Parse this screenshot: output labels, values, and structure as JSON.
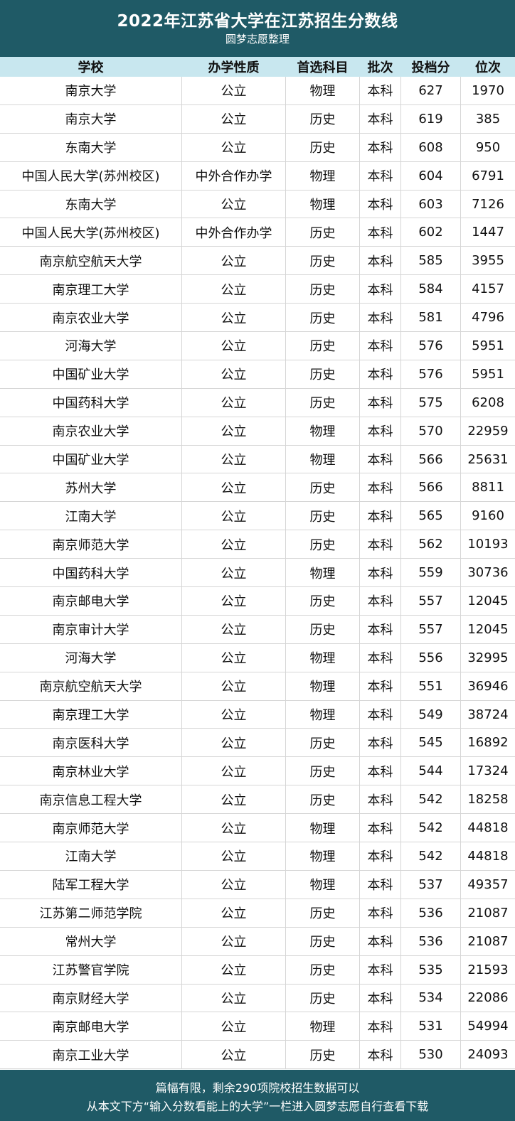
{
  "header": {
    "title": "2022年江苏省大学在江苏招生分数线",
    "subtitle": "圆梦志愿整理"
  },
  "columns": [
    "学校",
    "办学性质",
    "首选科目",
    "批次",
    "投档分",
    "位次"
  ],
  "rows": [
    [
      "南京大学",
      "公立",
      "物理",
      "本科",
      "627",
      "1970"
    ],
    [
      "南京大学",
      "公立",
      "历史",
      "本科",
      "619",
      "385"
    ],
    [
      "东南大学",
      "公立",
      "历史",
      "本科",
      "608",
      "950"
    ],
    [
      "中国人民大学(苏州校区)",
      "中外合作办学",
      "物理",
      "本科",
      "604",
      "6791"
    ],
    [
      "东南大学",
      "公立",
      "物理",
      "本科",
      "603",
      "7126"
    ],
    [
      "中国人民大学(苏州校区)",
      "中外合作办学",
      "历史",
      "本科",
      "602",
      "1447"
    ],
    [
      "南京航空航天大学",
      "公立",
      "历史",
      "本科",
      "585",
      "3955"
    ],
    [
      "南京理工大学",
      "公立",
      "历史",
      "本科",
      "584",
      "4157"
    ],
    [
      "南京农业大学",
      "公立",
      "历史",
      "本科",
      "581",
      "4796"
    ],
    [
      "河海大学",
      "公立",
      "历史",
      "本科",
      "576",
      "5951"
    ],
    [
      "中国矿业大学",
      "公立",
      "历史",
      "本科",
      "576",
      "5951"
    ],
    [
      "中国药科大学",
      "公立",
      "历史",
      "本科",
      "575",
      "6208"
    ],
    [
      "南京农业大学",
      "公立",
      "物理",
      "本科",
      "570",
      "22959"
    ],
    [
      "中国矿业大学",
      "公立",
      "物理",
      "本科",
      "566",
      "25631"
    ],
    [
      "苏州大学",
      "公立",
      "历史",
      "本科",
      "566",
      "8811"
    ],
    [
      "江南大学",
      "公立",
      "历史",
      "本科",
      "565",
      "9160"
    ],
    [
      "南京师范大学",
      "公立",
      "历史",
      "本科",
      "562",
      "10193"
    ],
    [
      "中国药科大学",
      "公立",
      "物理",
      "本科",
      "559",
      "30736"
    ],
    [
      "南京邮电大学",
      "公立",
      "历史",
      "本科",
      "557",
      "12045"
    ],
    [
      "南京审计大学",
      "公立",
      "历史",
      "本科",
      "557",
      "12045"
    ],
    [
      "河海大学",
      "公立",
      "物理",
      "本科",
      "556",
      "32995"
    ],
    [
      "南京航空航天大学",
      "公立",
      "物理",
      "本科",
      "551",
      "36946"
    ],
    [
      "南京理工大学",
      "公立",
      "物理",
      "本科",
      "549",
      "38724"
    ],
    [
      "南京医科大学",
      "公立",
      "历史",
      "本科",
      "545",
      "16892"
    ],
    [
      "南京林业大学",
      "公立",
      "历史",
      "本科",
      "544",
      "17324"
    ],
    [
      "南京信息工程大学",
      "公立",
      "历史",
      "本科",
      "542",
      "18258"
    ],
    [
      "南京师范大学",
      "公立",
      "物理",
      "本科",
      "542",
      "44818"
    ],
    [
      "江南大学",
      "公立",
      "物理",
      "本科",
      "542",
      "44818"
    ],
    [
      "陆军工程大学",
      "公立",
      "物理",
      "本科",
      "537",
      "49357"
    ],
    [
      "江苏第二师范学院",
      "公立",
      "历史",
      "本科",
      "536",
      "21087"
    ],
    [
      "常州大学",
      "公立",
      "历史",
      "本科",
      "536",
      "21087"
    ],
    [
      "江苏警官学院",
      "公立",
      "历史",
      "本科",
      "535",
      "21593"
    ],
    [
      "南京财经大学",
      "公立",
      "历史",
      "本科",
      "534",
      "22086"
    ],
    [
      "南京邮电大学",
      "公立",
      "物理",
      "本科",
      "531",
      "54994"
    ],
    [
      "南京工业大学",
      "公立",
      "历史",
      "本科",
      "530",
      "24093"
    ]
  ],
  "footer": {
    "line1": "篇幅有限，剩余290项院校招生数据可以",
    "line2": "从本文下方“输入分数看能上的大学”一栏进入圆梦志愿自行查看下载"
  },
  "colors": {
    "header_bg": "#1f5a66",
    "column_header_bg": "#c8e7ef",
    "grid_line": "#d6d6d6"
  }
}
